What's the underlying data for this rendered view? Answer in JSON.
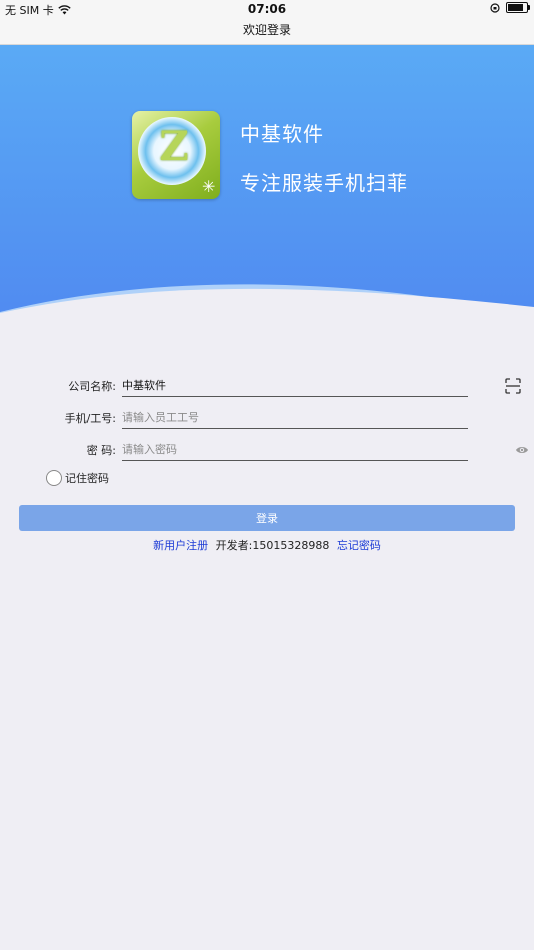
{
  "status_bar": {
    "carrier": "无 SIM 卡",
    "time": "07:06"
  },
  "nav": {
    "title": "欢迎登录"
  },
  "banner": {
    "brand_name": "中基软件",
    "slogan": "专注服装手机扫菲",
    "logo_letter": "Z",
    "colors": {
      "top": "#5aaaf5",
      "bottom": "#4f86f0"
    }
  },
  "form": {
    "company": {
      "label": "公司名称:",
      "value": "中基软件"
    },
    "phone": {
      "label": "手机/工号:",
      "placeholder": "请输入员工工号"
    },
    "password": {
      "label": "密 码:",
      "placeholder": "请输入密码"
    },
    "remember_label": "记住密码",
    "login_label": "登录"
  },
  "links": {
    "register": "新用户注册",
    "developer": "开发者:15015328988",
    "forgot": "忘记密码"
  },
  "icons": [
    "wifi-icon",
    "orientation-lock-icon",
    "battery-icon",
    "scan-icon",
    "eye-icon"
  ]
}
